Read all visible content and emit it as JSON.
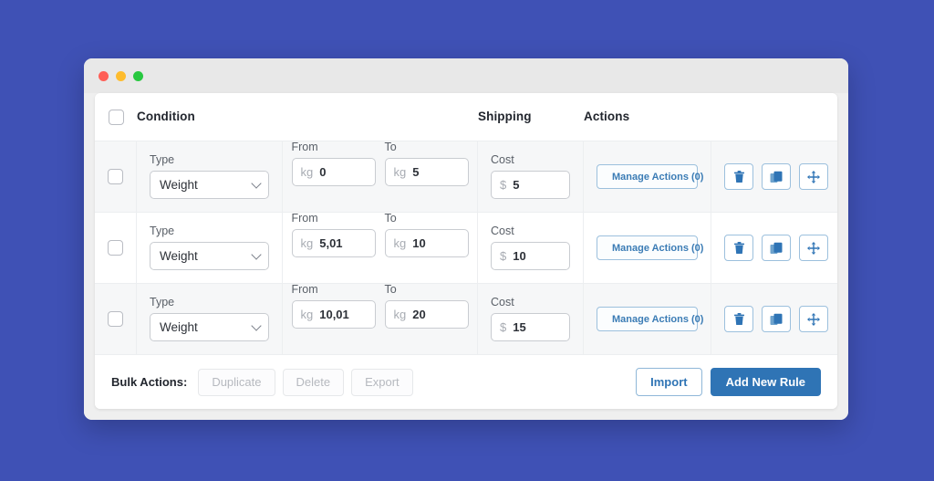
{
  "theme": {
    "page_background": "#3f51b5",
    "accent_blue": "#2f74b5",
    "icon_blue": "#3b7cb5",
    "row_shaded": "#f6f7f8"
  },
  "window": {
    "dots": [
      "close-red",
      "minimize-yellow",
      "maximize-green"
    ]
  },
  "table": {
    "headers": {
      "condition": "Condition",
      "shipping": "Shipping",
      "actions": "Actions"
    },
    "field_labels": {
      "type": "Type",
      "from": "From",
      "to": "To",
      "cost": "Cost"
    },
    "rows": [
      {
        "type": "Weight",
        "from_prefix": "kg",
        "from_value": "0",
        "to_prefix": "kg",
        "to_value": "5",
        "cost_prefix": "$",
        "cost_value": "5",
        "manage_label": "Manage Actions (0)"
      },
      {
        "type": "Weight",
        "from_prefix": "kg",
        "from_value": "5,01",
        "to_prefix": "kg",
        "to_value": "10",
        "cost_prefix": "$",
        "cost_value": "10",
        "manage_label": "Manage Actions (0)"
      },
      {
        "type": "Weight",
        "from_prefix": "kg",
        "from_value": "10,01",
        "to_prefix": "kg",
        "to_value": "20",
        "cost_prefix": "$",
        "cost_value": "15",
        "manage_label": "Manage Actions (0)"
      }
    ],
    "row_tools": [
      {
        "icon": "trash-icon",
        "name": "delete-rule-button"
      },
      {
        "icon": "duplicate-icon",
        "name": "duplicate-rule-button"
      },
      {
        "icon": "move-icon",
        "name": "reorder-rule-handle"
      }
    ]
  },
  "footer": {
    "bulk_label": "Bulk Actions:",
    "bulk_buttons": [
      {
        "label": "Duplicate",
        "enabled": false
      },
      {
        "label": "Delete",
        "enabled": false
      },
      {
        "label": "Export",
        "enabled": false
      }
    ],
    "import_label": "Import",
    "add_rule_label": "Add New Rule"
  }
}
